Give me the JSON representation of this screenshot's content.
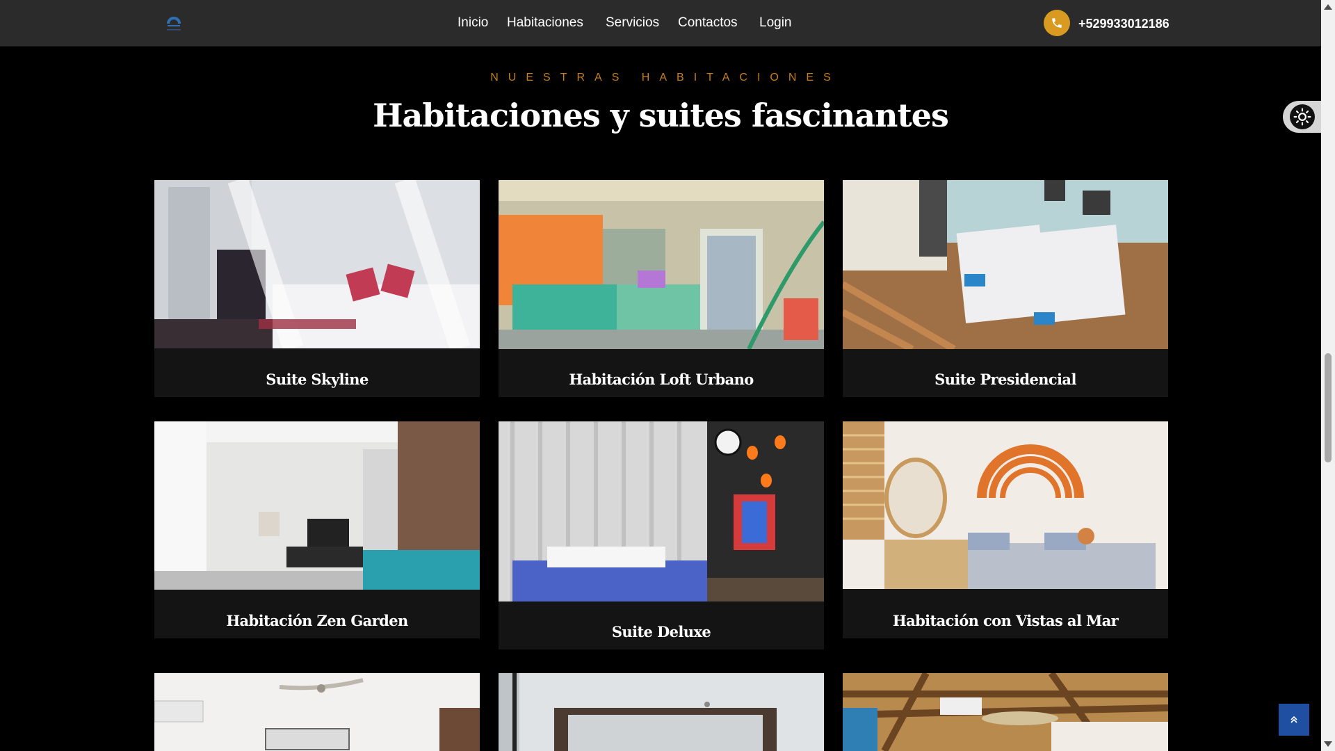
{
  "header": {
    "logo_icon": "hotel-logo-icon",
    "nav": [
      {
        "label": "Inicio"
      },
      {
        "label": "Habitaciones"
      },
      {
        "label": "Servicios"
      },
      {
        "label": "Contactos"
      },
      {
        "label": "Login"
      }
    ],
    "phone_icon": "phone-icon",
    "phone": "+529933012186",
    "accent_color": "#d99a22"
  },
  "section": {
    "eyebrow": "NUESTRAS HABITACIONES",
    "title": "Habitaciones y suites fascinantes",
    "eyebrow_color": "#c77f16"
  },
  "rooms": [
    {
      "name": "Suite Skyline",
      "image": "bedroom-canopy-bed-photo"
    },
    {
      "name": "Habitación Loft Urbano",
      "image": "bedroom-orange-curtains-photo"
    },
    {
      "name": "Suite Presidencial",
      "image": "bedroom-twin-beds-photo"
    },
    {
      "name": "Habitación Zen Garden",
      "image": "bedroom-white-modern-photo"
    },
    {
      "name": "Suite Deluxe",
      "image": "bedroom-blue-bed-art-photo"
    },
    {
      "name": "Habitación con Vistas al Mar",
      "image": "bedroom-rainbow-wall-photo"
    },
    {
      "name": "",
      "image": "bedroom-ceiling-fan-photo"
    },
    {
      "name": "",
      "image": "bedroom-modern-ceiling-photo"
    },
    {
      "name": "",
      "image": "bedroom-wood-beams-photo"
    }
  ],
  "controls": {
    "theme_toggle_icon": "sun-icon",
    "back_to_top_icon": "double-chevron-up-icon",
    "back_to_top_color": "#1f4fa0"
  }
}
